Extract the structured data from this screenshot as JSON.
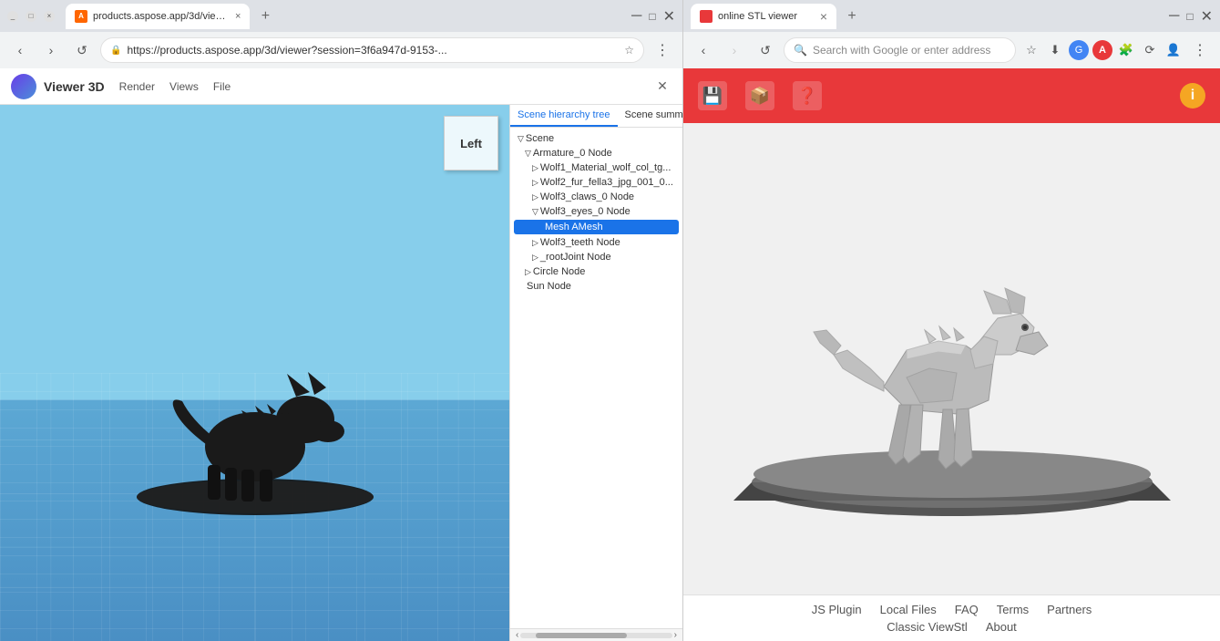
{
  "left_browser": {
    "tab_title": "products.aspose.app/3d/view...",
    "url": "https://products.aspose.app/3d/viewer?session=3f6a947d-9153-...",
    "app_title": "Viewer 3D",
    "app_menu": [
      "Render",
      "Views",
      "File"
    ],
    "nav_cube_label": "Left",
    "scene_tabs": [
      "Scene hierarchy tree",
      "Scene summary"
    ],
    "scene_tree": [
      {
        "label": "Scene",
        "level": 0,
        "arrow": "▽",
        "type": "node"
      },
      {
        "label": "Armature_0 Node",
        "level": 1,
        "arrow": "▽",
        "type": "node"
      },
      {
        "label": "Wolf1_Material_wolf_col_tg...",
        "level": 2,
        "arrow": "▷",
        "type": "node"
      },
      {
        "label": "Wolf2_fur_fella3_jpg_001_0...",
        "level": 2,
        "arrow": "▷",
        "type": "node"
      },
      {
        "label": "Wolf3_claws_0 Node",
        "level": 2,
        "arrow": "▷",
        "type": "node"
      },
      {
        "label": "Wolf3_eyes_0 Node",
        "level": 2,
        "arrow": "▽",
        "type": "node"
      },
      {
        "label": "Mesh AMesh",
        "level": 3,
        "arrow": "",
        "type": "selected"
      },
      {
        "label": "Wolf3_teeth Node",
        "level": 2,
        "arrow": "▷",
        "type": "node"
      },
      {
        "label": "_rootJoint Node",
        "level": 2,
        "arrow": "▷",
        "type": "node"
      },
      {
        "label": "Circle Node",
        "level": 1,
        "arrow": "▷",
        "type": "node"
      },
      {
        "label": "Sun Node",
        "level": 1,
        "arrow": "",
        "type": "node"
      }
    ]
  },
  "right_browser": {
    "tab_title": "online STL viewer",
    "search_placeholder": "Search with Google or enter address",
    "toolbar_buttons": [
      {
        "name": "save",
        "icon": "💾"
      },
      {
        "name": "box",
        "icon": "📦"
      },
      {
        "name": "help",
        "icon": "❓"
      }
    ],
    "info_badge": "i",
    "footer_links_row1": [
      "JS Plugin",
      "Local Files",
      "FAQ",
      "Terms",
      "Partners"
    ],
    "footer_links_row2": [
      "Classic ViewStl",
      "About"
    ]
  }
}
